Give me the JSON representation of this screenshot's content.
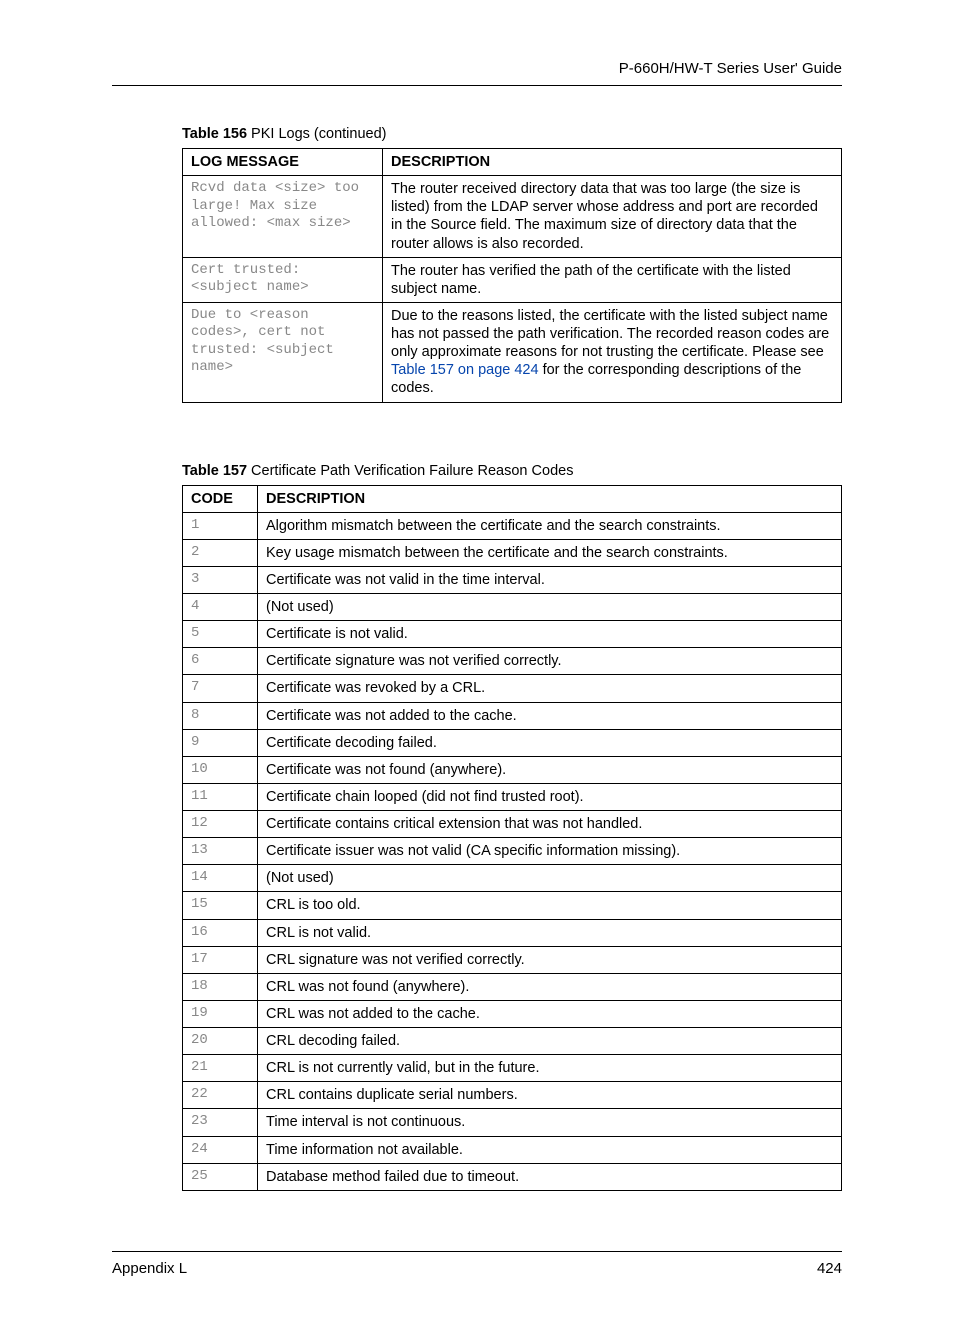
{
  "header": {
    "title": "P-660H/HW-T Series User' Guide"
  },
  "table1": {
    "caption_bold": "Table 156",
    "caption_rest": "   PKI Logs (continued)",
    "head1": "LOG MESSAGE",
    "head2": "DESCRIPTION",
    "rows": [
      {
        "msg": "Rcvd data <size> too large! Max size allowed: <max size>",
        "desc": "The router received directory data that was too large (the size is listed) from the LDAP server whose address and port are recorded in the Source field. The maximum size of directory data that the router allows is also recorded."
      },
      {
        "msg": "Cert trusted: <subject name>",
        "desc": "The router has verified the path of the certificate with the listed subject name."
      },
      {
        "msg": "Due to <reason codes>, cert not trusted: <subject name>",
        "desc_pre": "Due to the reasons listed, the certificate with the listed subject name has not passed the path verification. The recorded reason codes are only approximate reasons for not trusting the certificate. Please see ",
        "desc_link": "Table 157 on page 424",
        "desc_post": " for the corresponding descriptions of the codes."
      }
    ]
  },
  "table2": {
    "caption_bold": "Table 157",
    "caption_rest": "   Certificate Path Verification Failure Reason Codes",
    "head1": "CODE",
    "head2": "DESCRIPTION",
    "rows": [
      {
        "c": "1",
        "d": "Algorithm mismatch between the certificate and the search constraints."
      },
      {
        "c": "2",
        "d": "Key usage mismatch between the certificate and the search constraints."
      },
      {
        "c": "3",
        "d": "Certificate was not valid in the time interval."
      },
      {
        "c": "4",
        "d": "(Not used)"
      },
      {
        "c": "5",
        "d": "Certificate is not valid."
      },
      {
        "c": "6",
        "d": "Certificate signature was not verified correctly."
      },
      {
        "c": "7",
        "d": "Certificate was revoked by a CRL."
      },
      {
        "c": "8",
        "d": "Certificate was not added to the cache."
      },
      {
        "c": "9",
        "d": "Certificate decoding failed."
      },
      {
        "c": "10",
        "d": "Certificate was not found (anywhere)."
      },
      {
        "c": "11",
        "d": "Certificate chain looped (did not find trusted root)."
      },
      {
        "c": "12",
        "d": "Certificate contains critical extension that was not handled."
      },
      {
        "c": "13",
        "d": "Certificate issuer was not valid (CA specific information missing)."
      },
      {
        "c": "14",
        "d": "(Not used)"
      },
      {
        "c": "15",
        "d": "CRL is too old."
      },
      {
        "c": "16",
        "d": "CRL is not valid."
      },
      {
        "c": "17",
        "d": "CRL signature was not verified correctly."
      },
      {
        "c": "18",
        "d": "CRL was not found (anywhere)."
      },
      {
        "c": "19",
        "d": "CRL was not added to the cache."
      },
      {
        "c": "20",
        "d": "CRL decoding failed."
      },
      {
        "c": "21",
        "d": "CRL is not currently valid, but in the future."
      },
      {
        "c": "22",
        "d": "CRL contains duplicate serial numbers."
      },
      {
        "c": "23",
        "d": "Time interval is not continuous."
      },
      {
        "c": "24",
        "d": "Time information not available."
      },
      {
        "c": "25",
        "d": "Database method failed due to timeout."
      }
    ]
  },
  "footer": {
    "left": "Appendix L",
    "right": "424"
  }
}
